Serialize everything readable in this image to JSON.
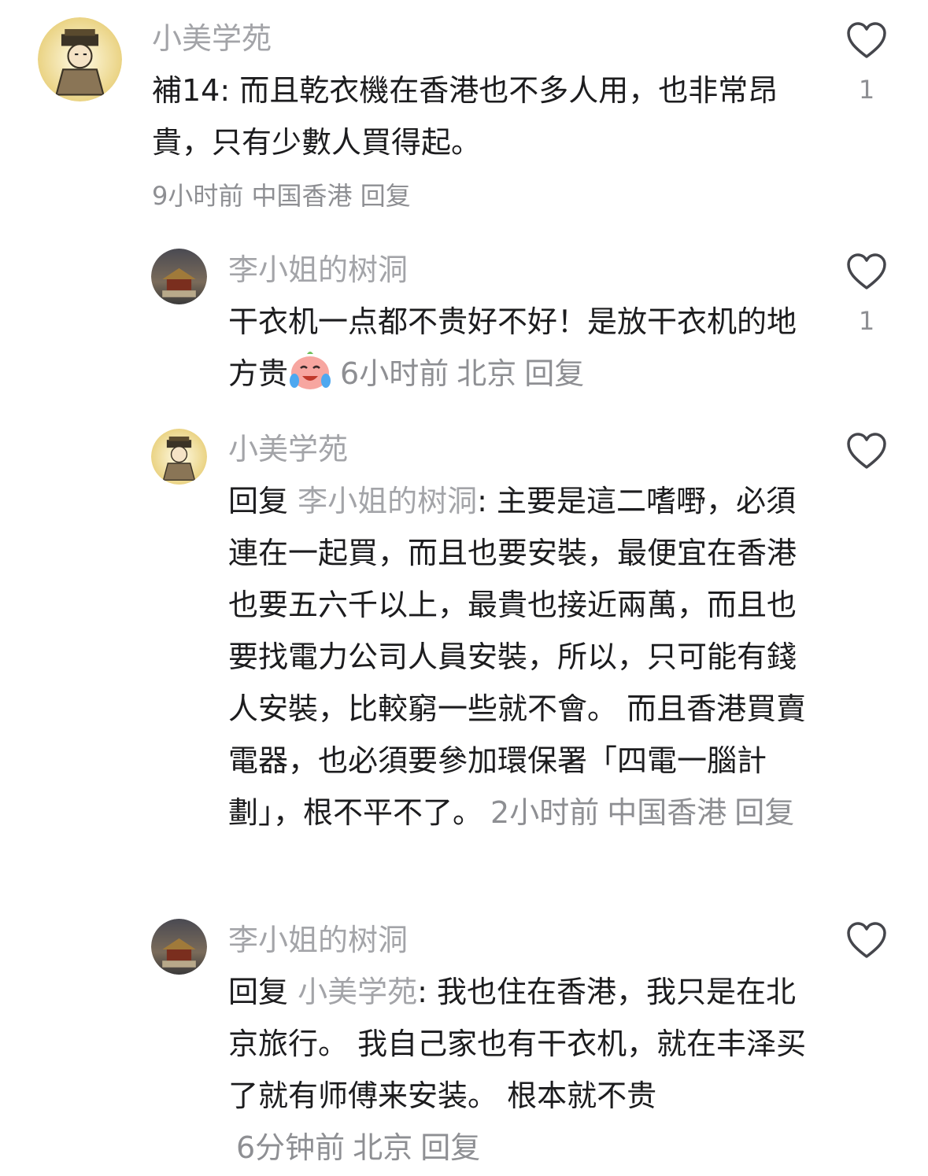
{
  "comments": [
    {
      "author": "小美学苑",
      "text": "補14: 而且乾衣機在香港也不多人用，也非常昂貴，只有少數人買得起。",
      "time": "9小时前",
      "location": "中国香港",
      "reply": "回复",
      "likes": "1",
      "avatar": "emperor-avatar-icon"
    },
    {
      "author": "李小姐的树洞",
      "text": "干衣机一点都不贵好不好！是放干衣机的地方贵",
      "emoji": "crying-laughing-emoji",
      "time": "6小时前",
      "location": "北京",
      "reply": "回复",
      "likes": "1",
      "avatar": "palace-avatar-icon"
    },
    {
      "author": "小美学苑",
      "reply_prefix": "回复",
      "mention": "李小姐的树洞",
      "text": ": 主要是這二嗜嘢，必須連在一起買，而且也要安裝，最便宜在香港也要五六千以上，最貴也接近兩萬，而且也要找電力公司人員安裝，所以，只可能有錢人安裝，比較窮一些就不會。 而且香港買賣電器，也必須要參加環保署「四電一腦計劃」，根不平不了。",
      "time": "2小时前",
      "location": "中国香港",
      "reply": "回复",
      "likes": "",
      "avatar": "emperor-avatar-icon"
    },
    {
      "author": "李小姐的树洞",
      "reply_prefix": "回复",
      "mention": "小美学苑",
      "text": ": 我也住在香港，我只是在北京旅行。 我自己家也有干衣机，就在丰泽买了就有师傅来安装。 根本就不贵",
      "time": "6分钟前",
      "location": "北京",
      "reply": "回复",
      "likes": "",
      "avatar": "palace-avatar-icon"
    }
  ],
  "colors": {
    "author": "#a3a4a8",
    "meta": "#8e8f93",
    "text": "#1c1c1e"
  }
}
